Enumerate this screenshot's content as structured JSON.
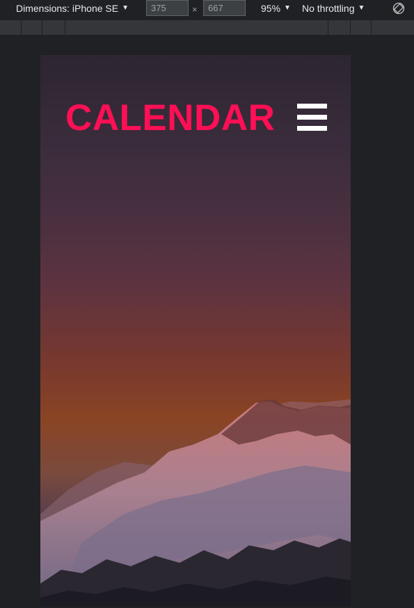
{
  "devtools": {
    "device_label": "Dimensions: iPhone SE",
    "width_value": "375",
    "height_value": "667",
    "times_sign": "×",
    "zoom": "95%",
    "throttling": "No throttling",
    "caret": "▼"
  },
  "page": {
    "brand_title": "CALENDAR",
    "menu_icon": "hamburger-menu-icon"
  },
  "colors": {
    "brand": "#ff0f55",
    "menu": "#ffffff"
  }
}
